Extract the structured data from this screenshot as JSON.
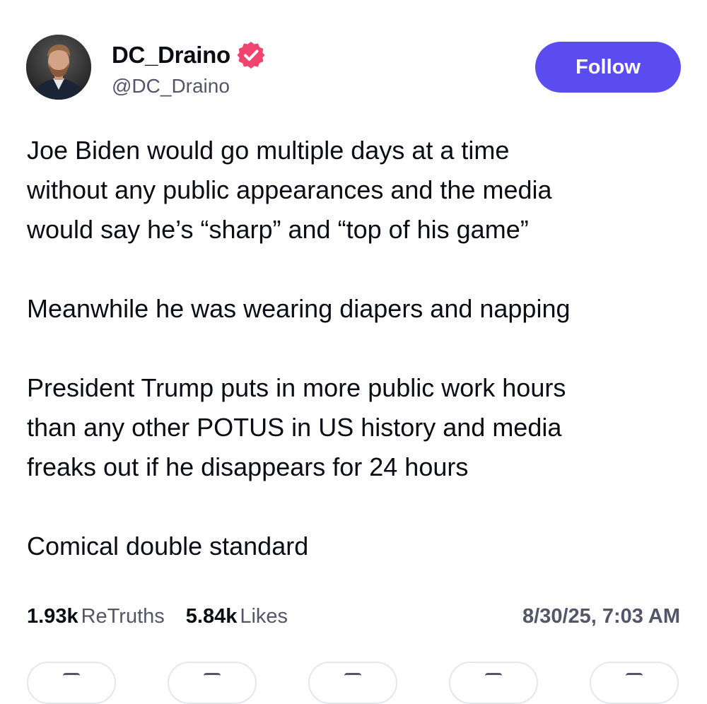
{
  "author": {
    "display_name": "DC_Draino",
    "handle": "@DC_Draino",
    "verified": true,
    "verified_color": "#f0446e",
    "avatar_icon": "profile-photo"
  },
  "follow_button": {
    "label": "Follow",
    "color": "#5b4cf0"
  },
  "post": {
    "paragraphs": [
      "Joe Biden would go multiple days at a time\nwithout any public appearances and the media\nwould say he’s “sharp” and “top of his game”",
      "Meanwhile he was wearing diapers and napping",
      "President Trump puts in more public work hours\nthan any other POTUS in US history and media\nfreaks out if he disappears for 24 hours",
      "Comical double standard"
    ]
  },
  "stats": {
    "retruths_count": "1.93k",
    "retruths_label": "ReTruths",
    "likes_count": "5.84k",
    "likes_label": "Likes",
    "timestamp": "8/30/25, 7:03 AM"
  },
  "actions": [
    {
      "icon": "reply-icon"
    },
    {
      "icon": "retruth-icon"
    },
    {
      "icon": "like-icon"
    },
    {
      "icon": "share-icon"
    },
    {
      "icon": "more-icon"
    }
  ]
}
